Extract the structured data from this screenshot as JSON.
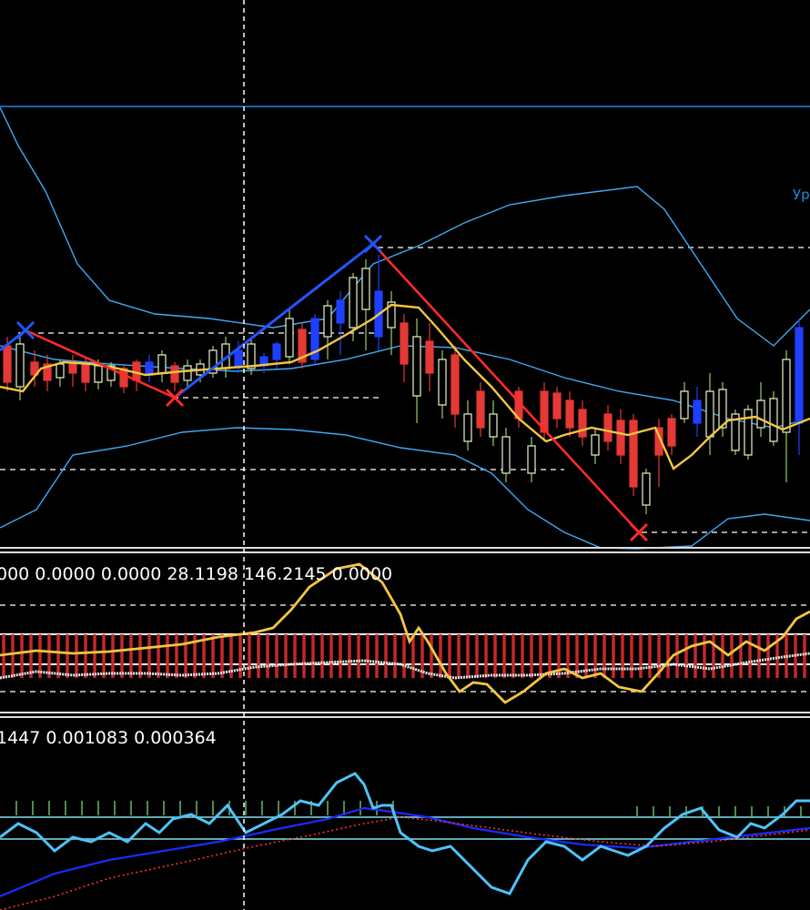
{
  "colors": {
    "background": "#000000",
    "bollinger": "#3fa9f5",
    "resistance": "#1e88e5",
    "candle_bull": "#ffffff",
    "candle_bear": "#e53935",
    "candle_green_wick": "#9ccc65",
    "candle_blue": "#1e40ff",
    "ma_yellow": "#f5c542",
    "zigzag_up": "#2255ff",
    "zigzag_down": "#ff2a2a",
    "dashed": "#ffffff",
    "separator": "#dddddd",
    "rsi_bar": "#c62828",
    "osc_cyan": "#4fc3f7",
    "osc_blue": "#1a2cff",
    "osc_red": "#ff3030",
    "osc_green_tick": "#66bb6a"
  },
  "corner_label": "Ур",
  "chart_data": [
    {
      "type": "candlestick",
      "panel": "price",
      "indicators": [
        "bollinger_bands",
        "moving_average",
        "zigzag"
      ],
      "zigzag_points": [
        {
          "index": 1,
          "kind": "high"
        },
        {
          "index": 11,
          "kind": "low"
        },
        {
          "index": 23,
          "kind": "high"
        },
        {
          "index": 40,
          "kind": "low"
        }
      ],
      "grid": false
    },
    {
      "type": "histogram_line",
      "panel": "indicator_1",
      "label": "000 0.0000 0.0000 28.1198 146.2145 0.0000"
    },
    {
      "type": "line",
      "panel": "indicator_2",
      "label": "1447 0.001083 0.000364"
    }
  ]
}
